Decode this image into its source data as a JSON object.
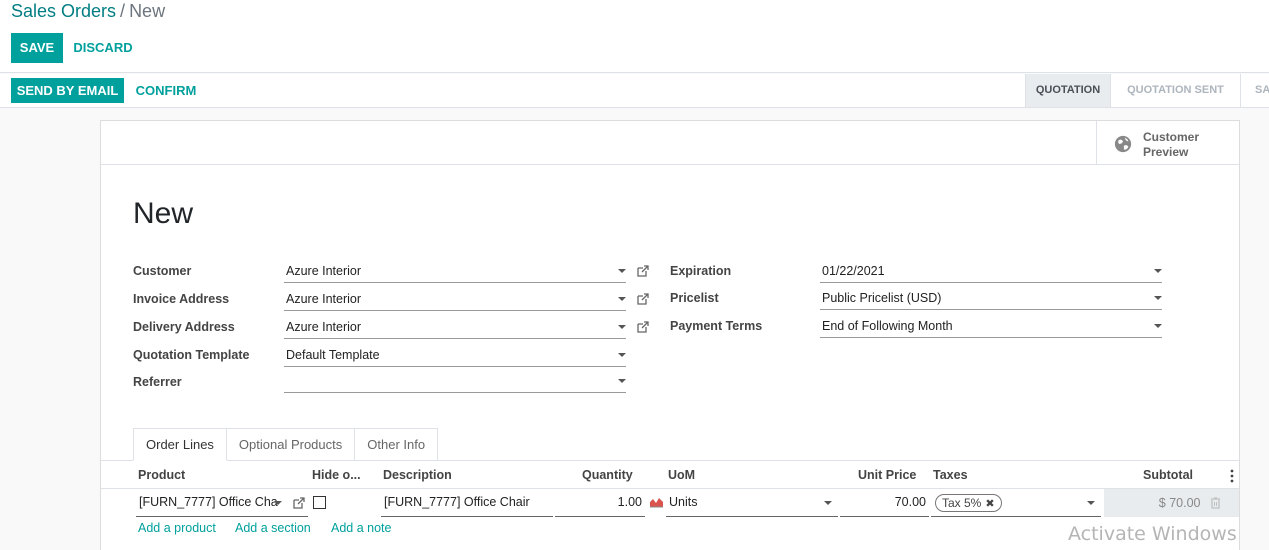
{
  "breadcrumb": {
    "parent": "Sales Orders",
    "separator": "/",
    "current": "New"
  },
  "control_panel": {
    "save_label": "SAVE",
    "discard_label": "DISCARD"
  },
  "statusbar": {
    "send_by_email_label": "SEND BY EMAIL",
    "confirm_label": "CONFIRM",
    "stages": [
      {
        "label": "QUOTATION",
        "active": true
      },
      {
        "label": "QUOTATION SENT",
        "active": false
      },
      {
        "label": "SA",
        "active": false
      }
    ]
  },
  "button_box": {
    "customer_preview_label": "Customer Preview",
    "icon": "globe-icon"
  },
  "form": {
    "title": "New",
    "left_fields": [
      {
        "label": "Customer",
        "value": "Azure Interior",
        "external_link": true
      },
      {
        "label": "Invoice Address",
        "value": "Azure Interior",
        "external_link": true
      },
      {
        "label": "Delivery Address",
        "value": "Azure Interior",
        "external_link": true
      },
      {
        "label": "Quotation Template",
        "value": "Default Template",
        "external_link": false
      },
      {
        "label": "Referrer",
        "value": "",
        "external_link": false
      }
    ],
    "right_fields": [
      {
        "label": "Expiration",
        "value": "01/22/2021"
      },
      {
        "label": "Pricelist",
        "value": "Public Pricelist (USD)"
      },
      {
        "label": "Payment Terms",
        "value": "End of Following Month"
      }
    ]
  },
  "tabs": [
    "Order Lines",
    "Optional Products",
    "Other Info"
  ],
  "order_lines": {
    "columns": {
      "product": "Product",
      "hide": "Hide o...",
      "description": "Description",
      "quantity": "Quantity",
      "uom": "UoM",
      "unit_price": "Unit Price",
      "taxes": "Taxes",
      "subtotal": "Subtotal"
    },
    "row": {
      "product": "[FURN_7777] Office Cha",
      "description": "[FURN_7777] Office Chair",
      "quantity": "1.00",
      "uom": "Units",
      "unit_price": "70.00",
      "tax": "Tax 5%",
      "subtotal": "$ 70.00"
    },
    "add_product": "Add a product",
    "add_section": "Add a section",
    "add_note": "Add a note"
  },
  "watermark": "Activate Windows",
  "colors": {
    "primary": "#00a09d",
    "link": "#017e84"
  }
}
